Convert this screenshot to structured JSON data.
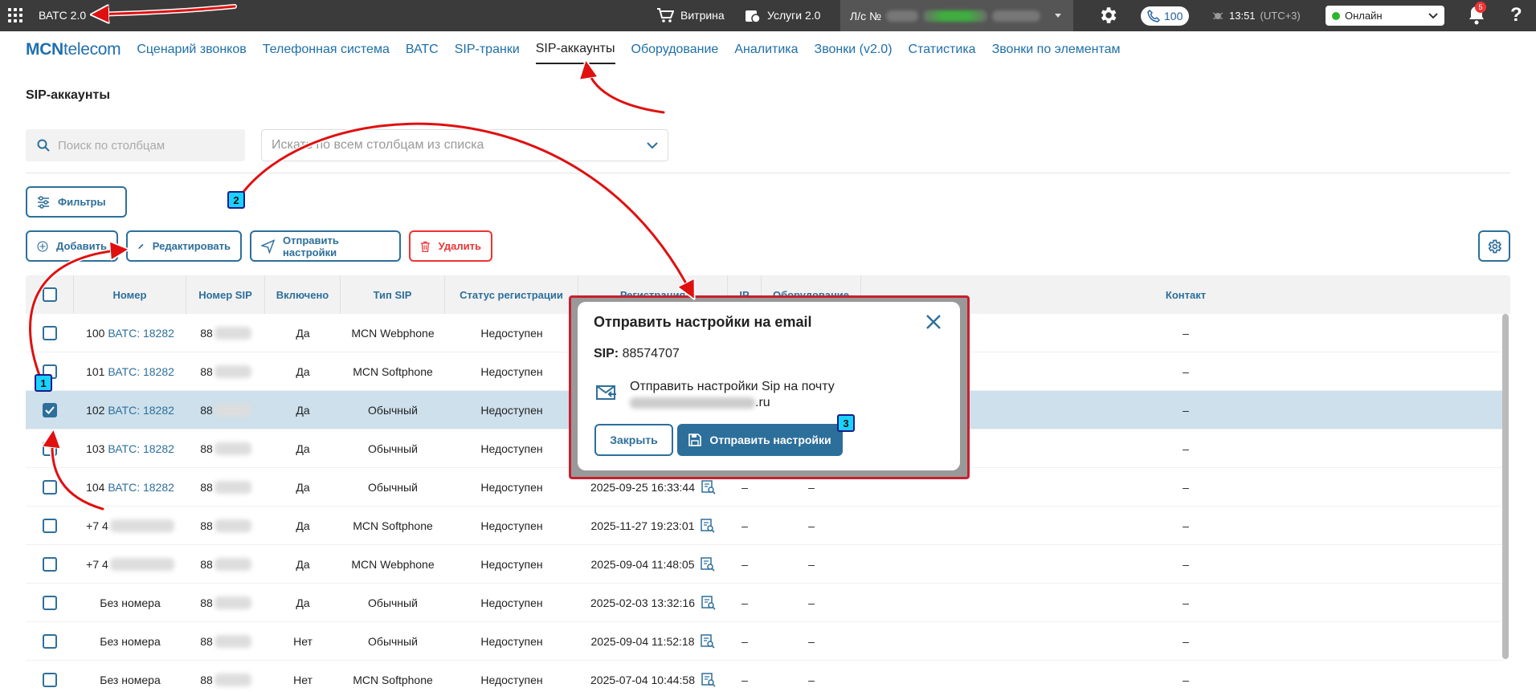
{
  "topbar": {
    "app_title": "ВАТС 2.0",
    "showcase": "Витрина",
    "services": "Услуги 2.0",
    "account_label": "Л/с №",
    "calls_count": "100",
    "time": "13:51",
    "timezone": "(UTC+3)",
    "status": "Онлайн",
    "notifications": "5",
    "help": "?"
  },
  "nav": {
    "logo_bold": "MCN",
    "logo_rest": "telecom",
    "items": [
      "Сценарий звонков",
      "Телефонная система",
      "ВАТС",
      "SIP-транки",
      "SIP-аккаунты",
      "Оборудование",
      "Аналитика",
      "Звонки (v2.0)",
      "Статистика",
      "Звонки по элементам"
    ],
    "active_index": 4
  },
  "page": {
    "title": "SIP-аккаунты",
    "search_placeholder": "Поиск по столбцам",
    "column_select_placeholder": "Искать по всем столбцам из списка"
  },
  "toolbar": {
    "filters": "Фильтры",
    "add": "Добавить",
    "edit": "Редактировать",
    "send_settings": "Отправить настройки",
    "delete": "Удалить"
  },
  "table": {
    "columns": [
      "Номер",
      "Номер SIP",
      "Включено",
      "Тип SIP",
      "Статус регистрации",
      "Регистрация",
      "IP",
      "Оборудование",
      "Контакт"
    ],
    "rows": [
      {
        "number": "100",
        "vats": "ВАТС: 18282",
        "sip": "88",
        "enabled": "Да",
        "type": "MCN Webphone",
        "status": "Недоступен",
        "reg": "",
        "ip": "",
        "equip": "",
        "contact": "–",
        "checked": false
      },
      {
        "number": "101",
        "vats": "ВАТС: 18282",
        "sip": "88",
        "enabled": "Да",
        "type": "MCN Softphone",
        "status": "Недоступен",
        "reg": "",
        "ip": "",
        "equip": "",
        "contact": "–",
        "checked": false
      },
      {
        "number": "102",
        "vats": "ВАТС: 18282",
        "sip": "88",
        "enabled": "Да",
        "type": "Обычный",
        "status": "Недоступен",
        "reg": "",
        "ip": "",
        "equip": "",
        "contact": "–",
        "checked": true
      },
      {
        "number": "103",
        "vats": "ВАТС: 18282",
        "sip": "88",
        "enabled": "Да",
        "type": "Обычный",
        "status": "Недоступен",
        "reg": "",
        "ip": "",
        "equip": "",
        "contact": "–",
        "checked": false
      },
      {
        "number": "104",
        "vats": "ВАТС: 18282",
        "sip": "88",
        "enabled": "Да",
        "type": "Обычный",
        "status": "Недоступен",
        "reg": "2025-09-25 16:33:44",
        "ip": "–",
        "equip": "–",
        "contact": "–",
        "checked": false
      },
      {
        "number": "+7 4",
        "vats": "",
        "sip": "88",
        "enabled": "Да",
        "type": "MCN Softphone",
        "status": "Недоступен",
        "reg": "2025-11-27 19:23:01",
        "ip": "–",
        "equip": "–",
        "contact": "–",
        "checked": false
      },
      {
        "number": "+7 4",
        "vats": "",
        "sip": "88",
        "enabled": "Да",
        "type": "MCN Webphone",
        "status": "Недоступен",
        "reg": "2025-09-04 11:48:05",
        "ip": "–",
        "equip": "–",
        "contact": "–",
        "checked": false
      },
      {
        "number": "Без номера",
        "vats": "",
        "sip": "88",
        "enabled": "Да",
        "type": "Обычный",
        "status": "Недоступен",
        "reg": "2025-02-03 13:32:16",
        "ip": "–",
        "equip": "–",
        "contact": "–",
        "checked": false
      },
      {
        "number": "Без номера",
        "vats": "",
        "sip": "88",
        "enabled": "Нет",
        "type": "Обычный",
        "status": "Недоступен",
        "reg": "2025-09-04 11:52:18",
        "ip": "–",
        "equip": "–",
        "contact": "–",
        "checked": false
      },
      {
        "number": "Без номера",
        "vats": "",
        "sip": "88",
        "enabled": "Нет",
        "type": "MCN Softphone",
        "status": "Недоступен",
        "reg": "2025-07-04 10:44:58",
        "ip": "–",
        "equip": "–",
        "contact": "–",
        "checked": false
      }
    ]
  },
  "modal": {
    "title": "Отправить настройки на email",
    "sip_label": "SIP:",
    "sip_value": "88574707",
    "mail_text": "Отправить настройки Sip на почту",
    "mail_suffix": ".ru",
    "close_button": "Закрыть",
    "send_button": "Отправить настройки"
  },
  "markers": [
    "1",
    "2",
    "3"
  ],
  "colors": {
    "accent": "#2d6f9b",
    "danger": "#e33333",
    "topbar": "#3b3b3b",
    "selected_row": "#cde0ec",
    "annotation_arrow": "#e01010",
    "marker": "#19d2ff"
  }
}
